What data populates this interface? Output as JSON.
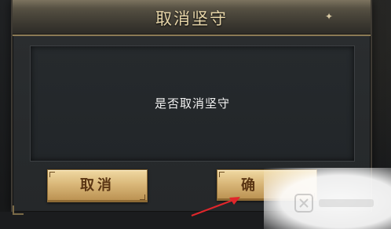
{
  "dialog": {
    "title": "取消坚守",
    "close_icon": "close-icon",
    "message": "是否取消坚守"
  },
  "buttons": {
    "cancel_label": "取消",
    "confirm_label": "确"
  },
  "colors": {
    "title_text": "#e6d5a8",
    "button_gold": "#d9b779",
    "button_text": "#5a3513",
    "message_text": "#f2f2f2",
    "annotation_arrow": "#e0262b"
  },
  "annotation": {
    "arrow_icon": "red-arrow-icon"
  }
}
